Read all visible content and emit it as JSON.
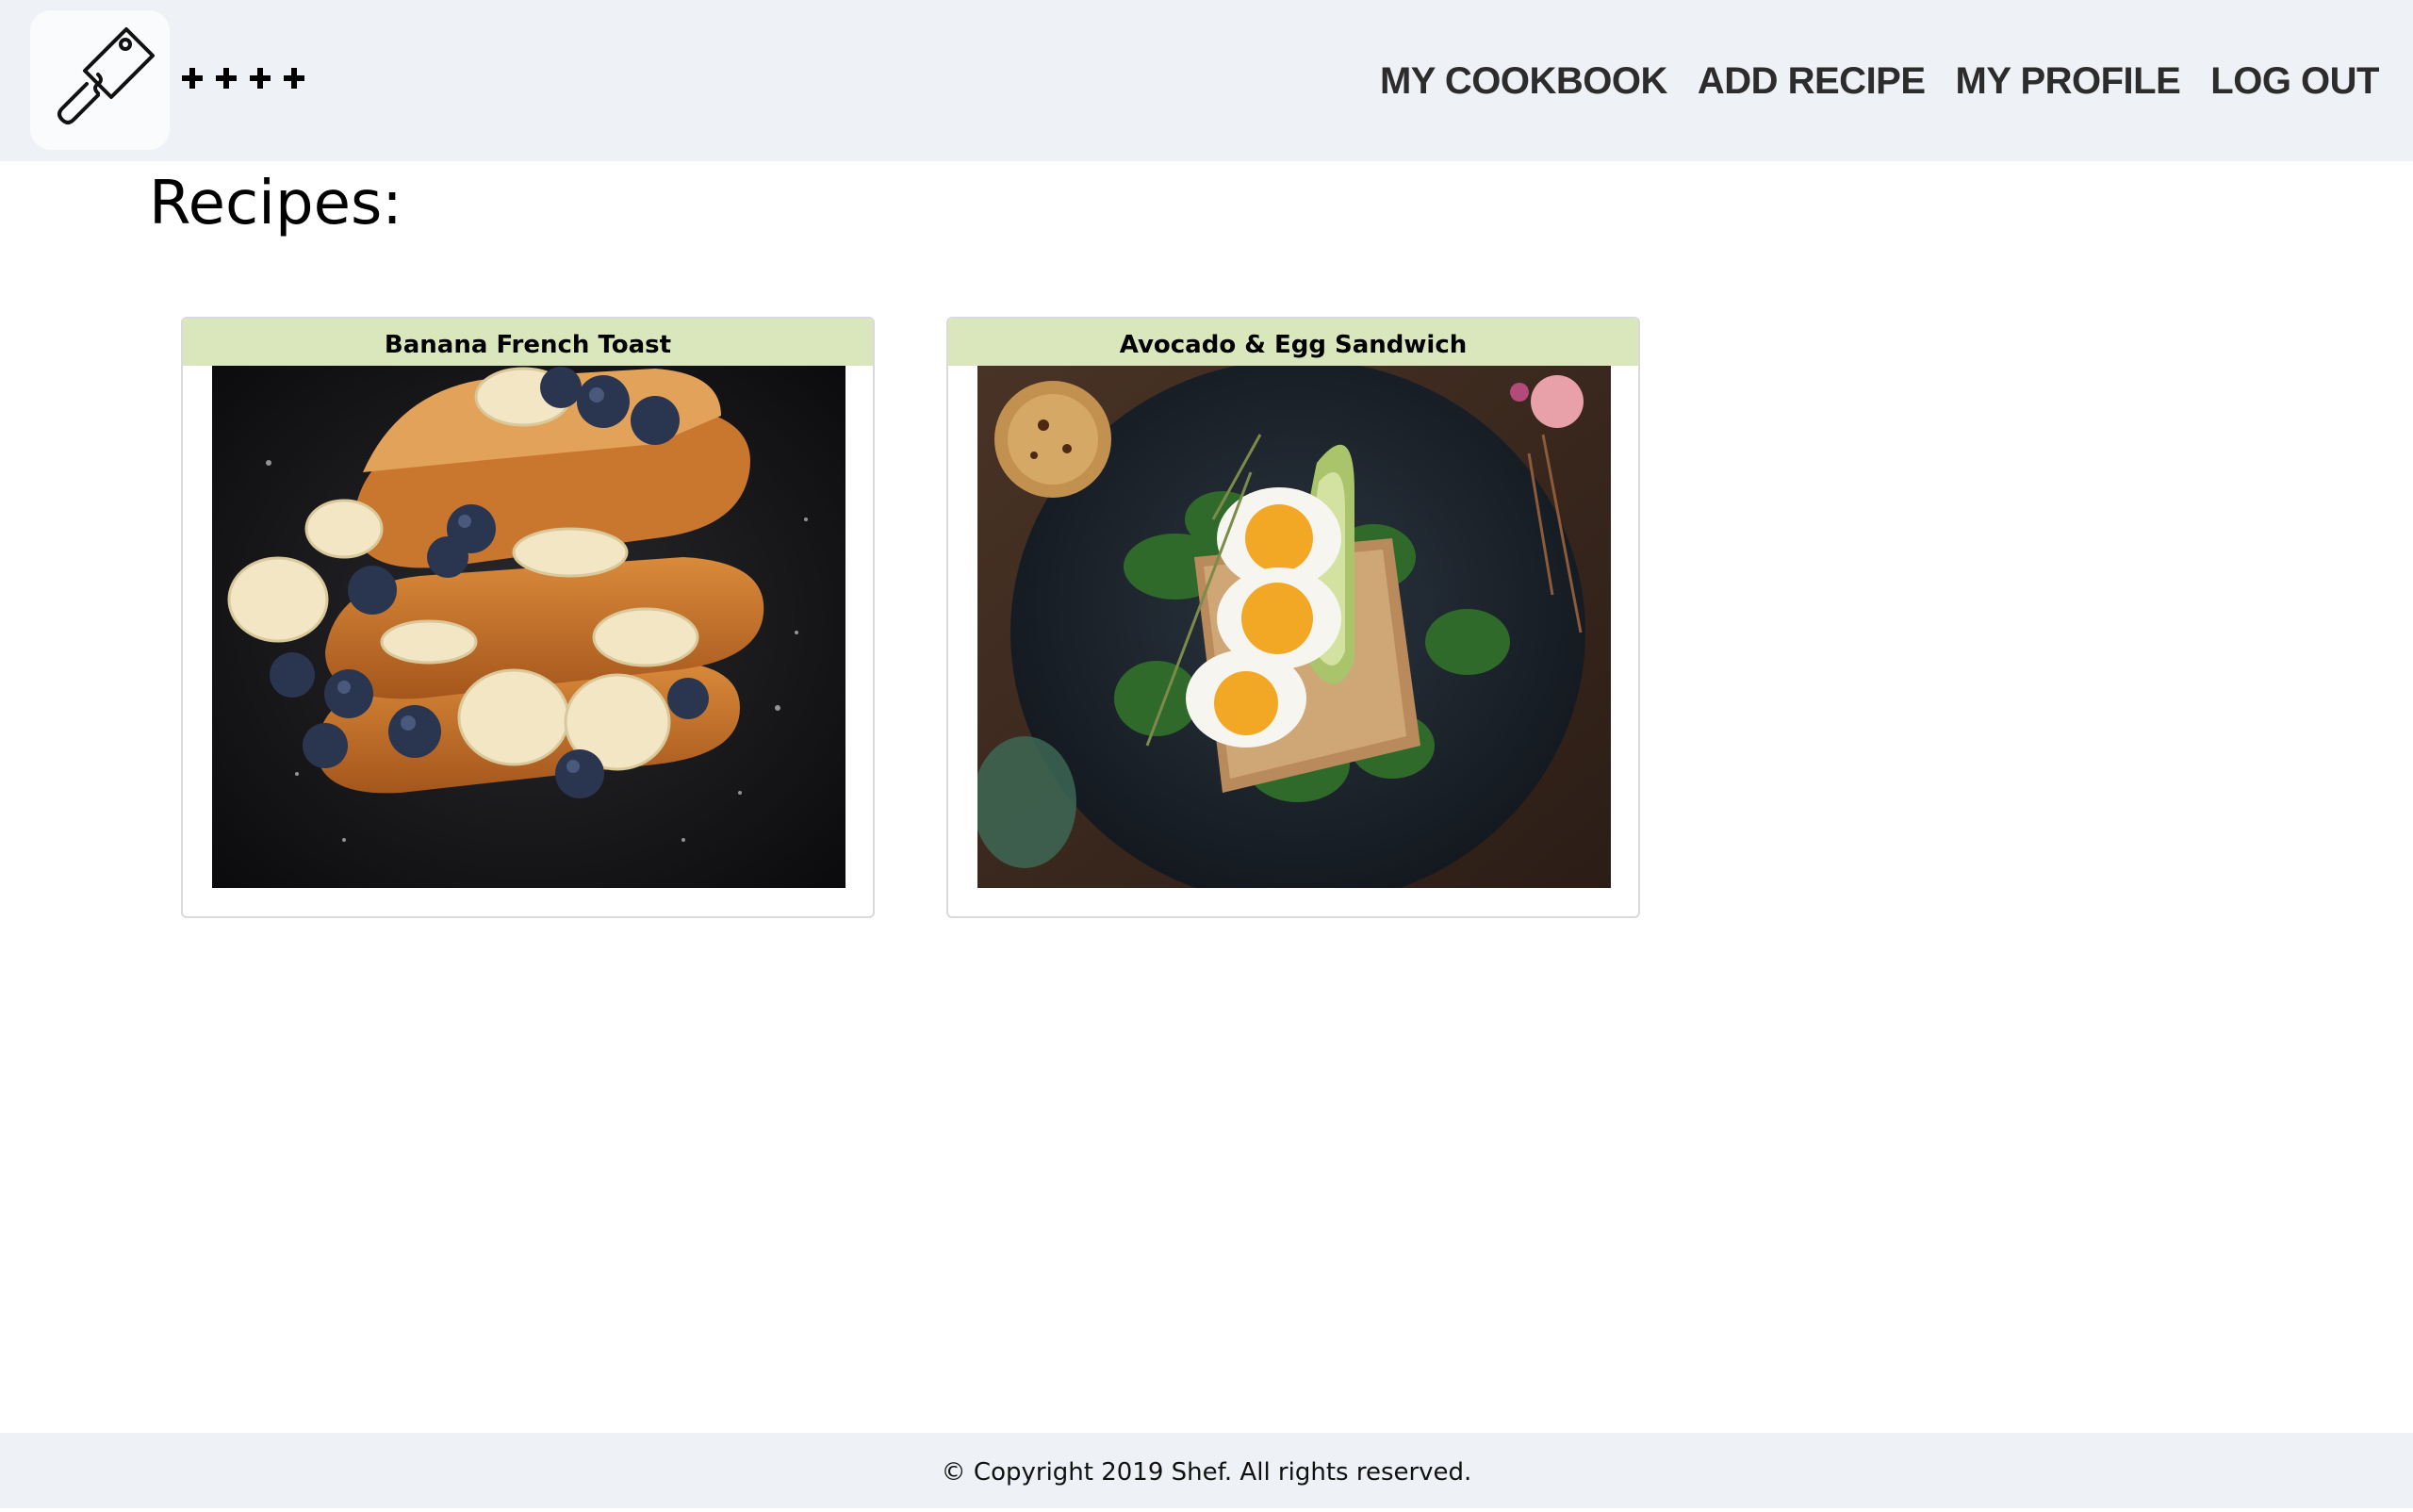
{
  "header": {
    "logo": {
      "icon": "cleaver-icon",
      "decoration": [
        "+",
        "+",
        "+",
        "+"
      ]
    },
    "nav": [
      {
        "id": "my-cookbook",
        "label": "MY COOKBOOK"
      },
      {
        "id": "add-recipe",
        "label": "ADD RECIPE"
      },
      {
        "id": "my-profile",
        "label": "MY PROFILE"
      },
      {
        "id": "log-out",
        "label": "LOG OUT"
      }
    ]
  },
  "main": {
    "title": "Recipes:",
    "recipes": [
      {
        "name": "Banana French Toast",
        "image": "french-toast-photo"
      },
      {
        "name": "Avocado & Egg Sandwich",
        "image": "avocado-egg-sandwich-photo"
      }
    ]
  },
  "footer": {
    "text": "© Copyright 2019 Shef. All rights reserved."
  },
  "colors": {
    "header_bg": "#eef1f6",
    "card_header_bg": "#dae7bc",
    "nav_text": "#2c2c2c",
    "card_border": "#dadada"
  }
}
